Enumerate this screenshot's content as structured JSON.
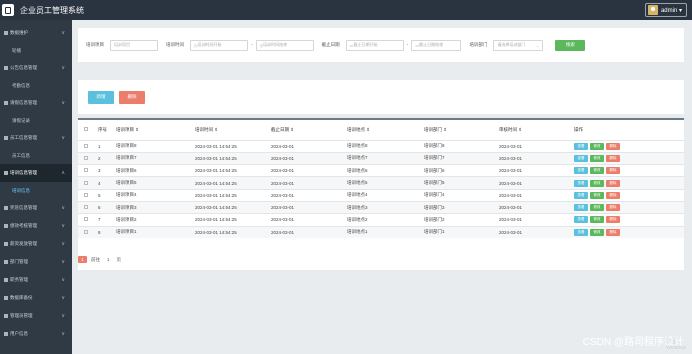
{
  "app": {
    "title": "企业员工管理系统",
    "user": "admin ▾"
  },
  "sidebar": {
    "items": [
      {
        "label": "数据维护",
        "type": "group"
      },
      {
        "label": "轮播",
        "type": "sub"
      },
      {
        "label": "公告信息管理",
        "type": "group"
      },
      {
        "label": "考勤信息",
        "type": "sub"
      },
      {
        "label": "请假信息管理",
        "type": "group"
      },
      {
        "label": "请假记录",
        "type": "sub"
      },
      {
        "label": "员工信息管理",
        "type": "group"
      },
      {
        "label": "员工信息",
        "type": "sub"
      },
      {
        "label": "培训信息管理",
        "type": "group",
        "active": true
      },
      {
        "label": "培训信息",
        "type": "sub",
        "active": true
      },
      {
        "label": "奖惩信息管理",
        "type": "group"
      },
      {
        "label": "绩效考核管理",
        "type": "group"
      },
      {
        "label": "薪资发放管理",
        "type": "group"
      },
      {
        "label": "部门管理",
        "type": "group"
      },
      {
        "label": "职务管理",
        "type": "group"
      },
      {
        "label": "数据库备份",
        "type": "group"
      },
      {
        "label": "管理员管理",
        "type": "group"
      },
      {
        "label": "用户信息",
        "type": "group"
      }
    ]
  },
  "search": {
    "name_label": "培训项目",
    "name_placeholder": "培训项目",
    "time_label": "培训时间",
    "time_from_placeholder": "培训时间开始",
    "time_to_placeholder": "培训时间结束",
    "deadline_label": "截止日期",
    "deadline_from_placeholder": "截止日期开始",
    "deadline_to_placeholder": "截止日期结束",
    "dept_label": "培训部门",
    "dept_placeholder": "请选择培训部门",
    "button": "搜索"
  },
  "actions": {
    "add": "新增",
    "delete": "删除"
  },
  "table": {
    "headers": [
      "序号",
      "培训项目 ⇕",
      "培训时间 ⇕",
      "截止日期 ⇕",
      "培训地点 ⇕",
      "培训部门 ⇕",
      "审核时间 ⇕",
      "操作"
    ],
    "row_buttons": {
      "view": "查看",
      "edit": "修改",
      "delete": "删除"
    },
    "rows": [
      [
        "1",
        "培训项目8",
        "2024-03-01 14:54:25",
        "2024-03-01",
        "培训地点8",
        "培训部门8",
        "2024-03-01"
      ],
      [
        "2",
        "培训项目7",
        "2024-03-01 14:54:25",
        "2024-03-01",
        "培训地点7",
        "培训部门7",
        "2024-03-01"
      ],
      [
        "3",
        "培训项目6",
        "2024-03-01 14:54:25",
        "2024-03-01",
        "培训地点6",
        "培训部门6",
        "2024-03-01"
      ],
      [
        "4",
        "培训项目5",
        "2024-03-01 14:54:25",
        "2024-03-01",
        "培训地点5",
        "培训部门5",
        "2024-03-01"
      ],
      [
        "5",
        "培训项目4",
        "2024-03-01 14:54:25",
        "2024-03-01",
        "培训地点4",
        "培训部门4",
        "2024-03-01"
      ],
      [
        "6",
        "培训项目3",
        "2024-03-01 14:54:25",
        "2024-03-01",
        "培训地点3",
        "培训部门3",
        "2024-03-01"
      ],
      [
        "7",
        "培训项目2",
        "2024-03-01 14:54:25",
        "2024-03-01",
        "培训地点2",
        "培训部门2",
        "2024-03-01"
      ],
      [
        "8",
        "培训项目1",
        "2024-03-01 14:54:25",
        "2024-03-01",
        "培训地点1",
        "培训部门1",
        "2024-03-01"
      ]
    ]
  },
  "pager": {
    "current": "1",
    "goto": "前往",
    "page": "1",
    "unit": "页"
  },
  "watermark": "CSDN @路司程序设计",
  "faint_text": "激活 Windows"
}
